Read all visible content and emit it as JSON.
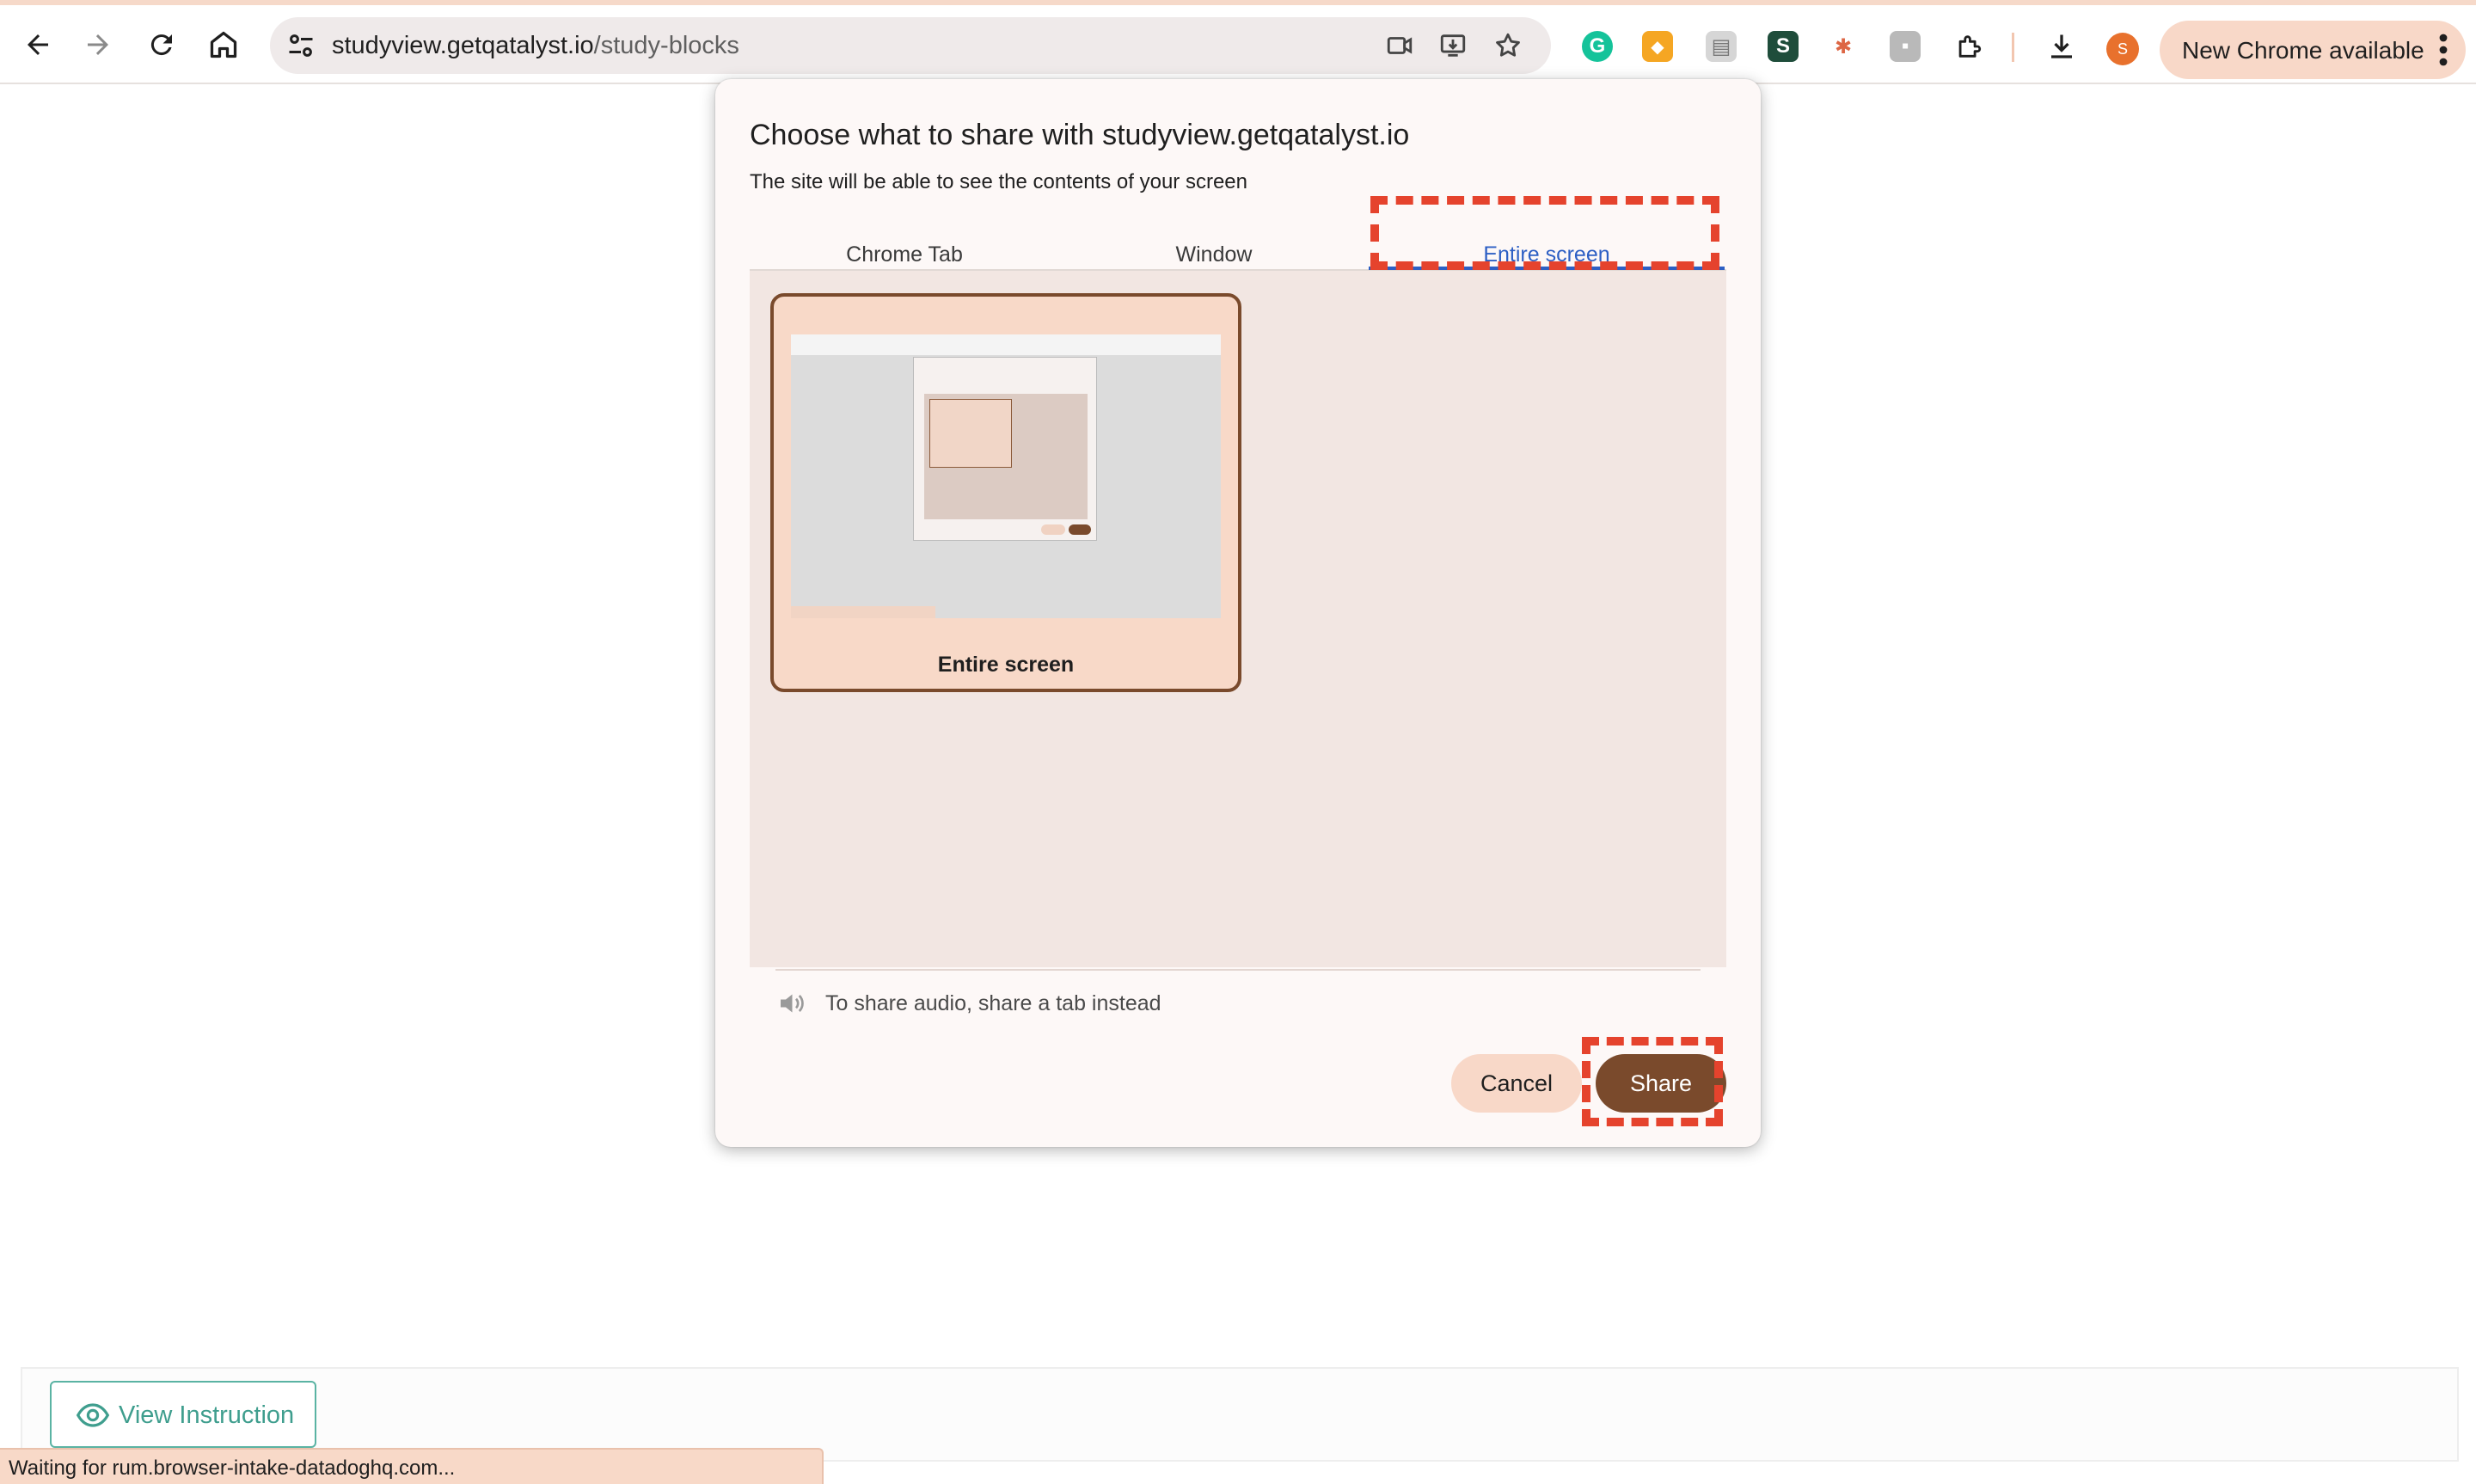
{
  "browser": {
    "url_host": "studyview.getqatalyst.io",
    "url_path": "/study-blocks",
    "new_chrome_label": "New Chrome available",
    "profile_initial": "S",
    "extensions": [
      "grammarly-icon",
      "brave-icon",
      "clipboard-icon",
      "scribe-icon",
      "pinwheel-icon",
      "photo-extension-icon",
      "puzzle-icon"
    ]
  },
  "dialog": {
    "title": "Choose what to share with studyview.getqatalyst.io",
    "subtitle": "The site will be able to see the contents of your screen",
    "tabs": [
      "Chrome Tab",
      "Window",
      "Entire screen"
    ],
    "active_tab": "Entire screen",
    "source_label": "Entire screen",
    "audio_note": "To share audio, share a tab instead",
    "cancel_label": "Cancel",
    "share_label": "Share"
  },
  "page": {
    "view_instruction_label": "View Instruction",
    "status_text": "Waiting for rum.browser-intake-datadoghq.com..."
  },
  "colors": {
    "accent_brown": "#7a4a2c",
    "tab_blue": "#2d5fc4",
    "annotation_red": "#e5432d",
    "teal": "#3f9e8e"
  }
}
